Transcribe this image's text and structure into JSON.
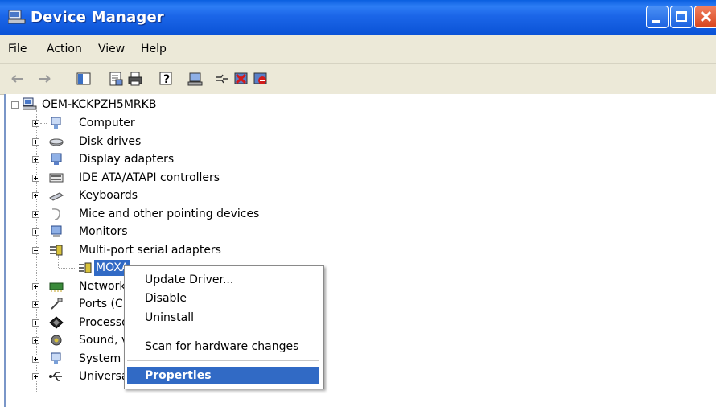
{
  "window": {
    "title": "Device Manager",
    "title_icon": "device-manager-icon",
    "buttons": [
      "minimize-icon",
      "maximize-icon",
      "close-icon"
    ]
  },
  "menubar": {
    "items": [
      "File",
      "Action",
      "View",
      "Help"
    ]
  },
  "toolbar": {
    "tools": [
      "back-arrow-icon",
      "forward-arrow-icon",
      "show-hide-console-tree-icon",
      "properties-icon",
      "print-icon",
      "help-icon",
      "scan-hardware-icon",
      "update-driver-icon",
      "uninstall-icon",
      "disable-icon"
    ]
  },
  "tree": {
    "root": "OEM-KCKPZH5MRKB",
    "items": [
      {
        "label": "Computer",
        "icon": "computer-icon"
      },
      {
        "label": "Disk drives",
        "icon": "disk-drive-icon"
      },
      {
        "label": "Display adapters",
        "icon": "display-adapter-icon"
      },
      {
        "label": "IDE ATA/ATAPI controllers",
        "icon": "ide-controller-icon"
      },
      {
        "label": "Keyboards",
        "icon": "keyboard-icon"
      },
      {
        "label": "Mice and other pointing devices",
        "icon": "mouse-icon"
      },
      {
        "label": "Monitors",
        "icon": "monitor-icon"
      },
      {
        "label": "Multi-port serial adapters",
        "icon": "serial-adapter-icon"
      },
      {
        "label": "MOXA",
        "icon": "serial-adapter-icon"
      },
      {
        "label": "Network",
        "icon": "network-icon"
      },
      {
        "label": "Ports (C",
        "icon": "port-icon"
      },
      {
        "label": "Processo",
        "icon": "processor-icon"
      },
      {
        "label": "Sound, v",
        "icon": "sound-icon"
      },
      {
        "label": "System d",
        "icon": "system-icon"
      },
      {
        "label": "Universa",
        "icon": "usb-icon"
      }
    ]
  },
  "context_menu": {
    "items": [
      "Update Driver...",
      "Disable",
      "Uninstall",
      "Scan for hardware changes",
      "Properties"
    ],
    "highlighted": "Properties"
  },
  "colors": {
    "titlebar": "#0a52d6",
    "menubar": "#ece9d8",
    "selection": "#316ac5"
  }
}
